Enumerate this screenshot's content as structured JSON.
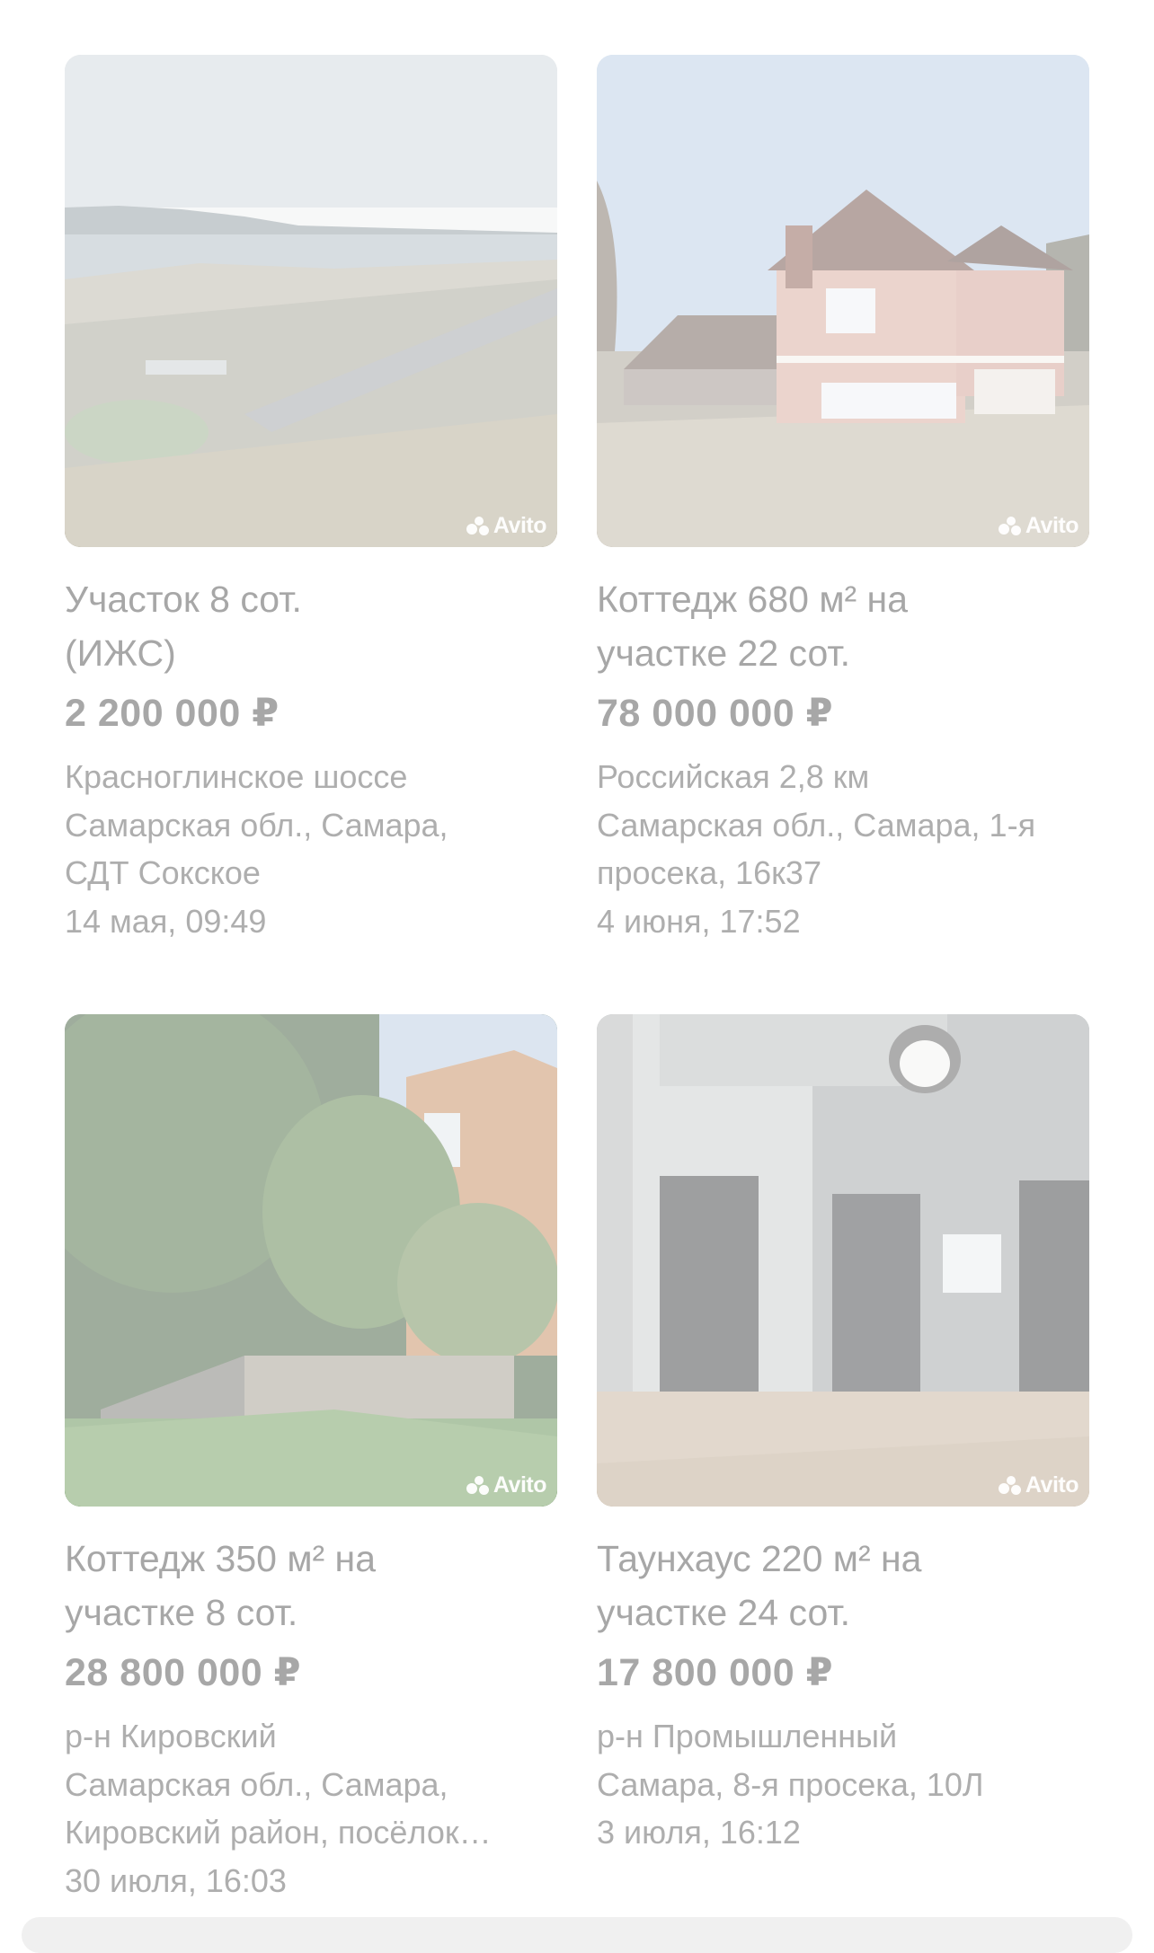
{
  "listings": [
    {
      "title": "Участок 8 сот.\n(ИЖС)",
      "price": "2 200 000 ₽",
      "address_lines": [
        "Красноглинское шоссе",
        "Самарская обл., Самара,",
        "СДТ Сокское"
      ],
      "date": "14 мая, 09:49",
      "watermark": "Avito"
    },
    {
      "title": "Коттедж 680 м² на\nучастке 22 сот.",
      "price": "78 000 000 ₽",
      "address_lines": [
        "Российская 2,8 км",
        "Самарская обл., Самара, 1-я",
        "просека, 16к37"
      ],
      "date": "4 июня, 17:52",
      "watermark": "Avito"
    },
    {
      "title": "Коттедж 350 м² на\nучастке 8 сот.",
      "price": "28 800 000 ₽",
      "address_lines": [
        "р-н Кировский",
        "Самарская обл., Самара,",
        "Кировский район, посёлок…"
      ],
      "date": "30 июля, 16:03",
      "watermark": "Avito"
    },
    {
      "title": "Таунхаус 220 м² на\nучастке 24 сот.",
      "price": "17 800 000 ₽",
      "address_lines": [
        "р-н Промышленный",
        "Самара, 8-я просека, 10Л"
      ],
      "date": "3 июля, 16:12",
      "watermark": "Avito"
    }
  ],
  "colors": {
    "text_muted": "#a7a7a7",
    "background": "#ffffff"
  }
}
